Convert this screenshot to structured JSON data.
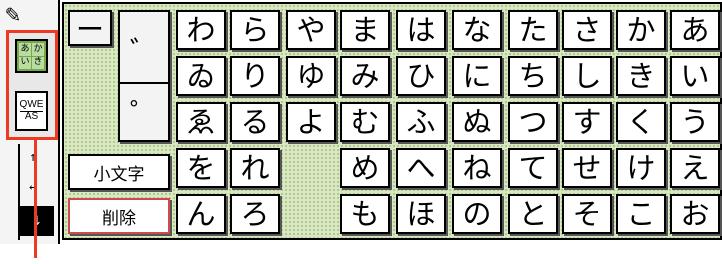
{
  "left_strip": {
    "pen_icon": "pencil-icon",
    "mode_kana_label": [
      "あ",
      "か",
      "い",
      "き"
    ],
    "mode_qwerty_label": [
      "QWE",
      "AS"
    ],
    "marks": [
      "↑",
      "↔",
      "↓"
    ]
  },
  "keyboard": {
    "long_vowel": "ー",
    "dakuten": "゛",
    "handakuten": "゜",
    "small_chars_label": "小文字",
    "delete_label": "削除",
    "row1": [
      "わ",
      "ら",
      "や",
      "ま",
      "は",
      "な",
      "た",
      "さ",
      "か",
      "あ"
    ],
    "row2": [
      "ゐ",
      "り",
      "ゆ",
      "み",
      "ひ",
      "に",
      "ち",
      "し",
      "き",
      "い"
    ],
    "row3": [
      "ゑ",
      "る",
      "よ",
      "む",
      "ふ",
      "ぬ",
      "つ",
      "す",
      "く",
      "う"
    ],
    "row4": [
      "を",
      "れ",
      "め",
      "へ",
      "ね",
      "て",
      "せ",
      "け",
      "え"
    ],
    "row5": [
      "ん",
      "ろ",
      "も",
      "ほ",
      "の",
      "と",
      "そ",
      "こ",
      "お"
    ]
  },
  "colors": {
    "panel_green": "#d9e8c2",
    "mode_green": "#78a84a",
    "highlight_red": "#ee3a25"
  }
}
